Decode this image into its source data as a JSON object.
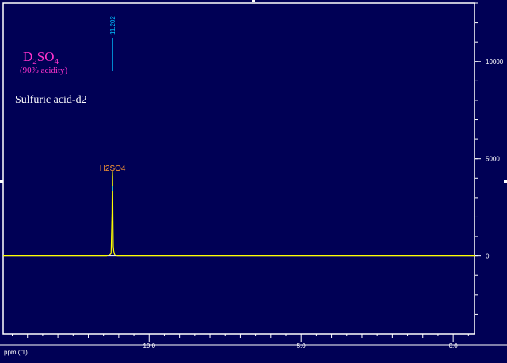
{
  "annotations": {
    "formula_main_1": "D",
    "formula_sub_1": "2",
    "formula_main_2": "SO",
    "formula_sub_2": "4",
    "acidity_note": "(90% acidity)",
    "compound_name": "Sulfuric acid-d2",
    "peak_label": "H2SO4",
    "peak_position_label": "11.202"
  },
  "axis": {
    "x_unit_label": "ppm (t1)"
  },
  "colors": {
    "background": "#000055",
    "frame": "#ffffff",
    "spectrum": "#ffff00",
    "baseline": "#ffffff",
    "peak_marker": "#00bfff",
    "formula": "#ff33cc",
    "compound_name": "#ffffff",
    "peak_label": "#ff9933",
    "tick_text": "#ffffff"
  },
  "chart_data": {
    "type": "line",
    "title": "",
    "xlabel": "ppm (t1)",
    "ylabel": "",
    "x_reversed": true,
    "xlim": [
      14.8,
      -0.7
    ],
    "ylim": [
      -4000,
      13000
    ],
    "x_ticks": [
      10.0,
      5.0,
      0.0
    ],
    "x_tick_labels": [
      "10.0",
      "5.0",
      "0.0"
    ],
    "y_ticks": [
      0,
      5000,
      10000
    ],
    "y_tick_labels": [
      "0",
      "5000",
      "10000"
    ],
    "grid": false,
    "series": [
      {
        "x": [
          14.8,
          11.4,
          11.3,
          11.25,
          11.22,
          11.21,
          11.202,
          11.19,
          11.18,
          11.16,
          11.12,
          11.05,
          -0.7
        ],
        "y": [
          0,
          0,
          60,
          150,
          2200,
          4400,
          4100,
          1800,
          500,
          180,
          50,
          0,
          0
        ]
      }
    ],
    "peaks": [
      {
        "x": 11.202,
        "label": "11.202"
      }
    ]
  }
}
